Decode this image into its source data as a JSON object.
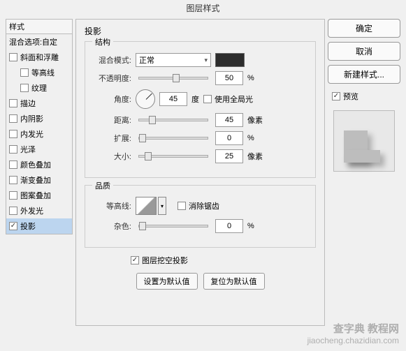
{
  "dialog": {
    "title": "图层样式"
  },
  "styles": {
    "header": "样式",
    "blend_options": "混合选项:自定",
    "items": [
      {
        "label": "斜面和浮雕",
        "checked": false,
        "indent": false
      },
      {
        "label": "等高线",
        "checked": false,
        "indent": true
      },
      {
        "label": "纹理",
        "checked": false,
        "indent": true
      },
      {
        "label": "描边",
        "checked": false,
        "indent": false
      },
      {
        "label": "内阴影",
        "checked": false,
        "indent": false
      },
      {
        "label": "内发光",
        "checked": false,
        "indent": false
      },
      {
        "label": "光泽",
        "checked": false,
        "indent": false
      },
      {
        "label": "颜色叠加",
        "checked": false,
        "indent": false
      },
      {
        "label": "渐变叠加",
        "checked": false,
        "indent": false
      },
      {
        "label": "图案叠加",
        "checked": false,
        "indent": false
      },
      {
        "label": "外发光",
        "checked": false,
        "indent": false
      },
      {
        "label": "投影",
        "checked": true,
        "indent": false
      }
    ]
  },
  "main": {
    "title": "投影",
    "structure": {
      "legend": "结构",
      "blend_mode_label": "混合模式:",
      "blend_mode_value": "正常",
      "color": "#2c2c2c",
      "opacity_label": "不透明度:",
      "opacity_value": "50",
      "opacity_unit": "%",
      "angle_label": "角度:",
      "angle_value": "45",
      "angle_unit": "度",
      "global_light_label": "使用全局光",
      "global_light_checked": false,
      "distance_label": "距离:",
      "distance_value": "45",
      "distance_unit": "像素",
      "spread_label": "扩展:",
      "spread_value": "0",
      "spread_unit": "%",
      "size_label": "大小:",
      "size_value": "25",
      "size_unit": "像素"
    },
    "quality": {
      "legend": "品质",
      "contour_label": "等高线:",
      "antialias_label": "消除锯齿",
      "antialias_checked": false,
      "noise_label": "杂色:",
      "noise_value": "0",
      "noise_unit": "%"
    },
    "knockout_label": "图层挖空投影",
    "knockout_checked": true,
    "make_default": "设置为默认值",
    "reset_default": "复位为默认值"
  },
  "right": {
    "ok": "确定",
    "cancel": "取消",
    "new_style": "新建样式...",
    "preview_label": "预览",
    "preview_checked": true
  },
  "watermark": {
    "brand": "查字典 教程网",
    "url": "jiaocheng.chazidian.com"
  }
}
